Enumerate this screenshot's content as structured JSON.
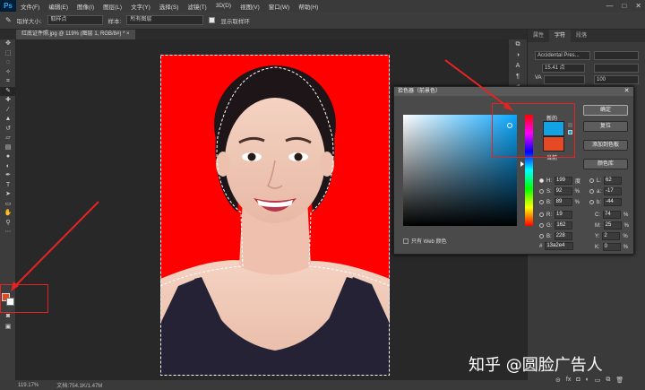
{
  "app": {
    "logo": "Ps"
  },
  "menu": [
    "文件(F)",
    "编辑(E)",
    "图像(I)",
    "图层(L)",
    "文字(Y)",
    "选择(S)",
    "滤镜(T)",
    "3D(D)",
    "视图(V)",
    "窗口(W)",
    "帮助(H)"
  ],
  "window_controls": [
    "—",
    "□",
    "✕"
  ],
  "options": {
    "sample_size_label": "取样大小:",
    "sample_size_value": "取样点",
    "sample_label": "样本:",
    "sample_value": "所有图层",
    "show_ring_label": "显示取样环"
  },
  "document_tab": "红底证件照.jpg @ 119% (图层 1, RGB/8#) * ×",
  "status": {
    "zoom": "119.17%",
    "doc": "文档:754.1K/1.47M"
  },
  "right_panel": {
    "tabs": [
      "属性",
      "字符",
      "段落"
    ],
    "active_tab": "字符",
    "font_family": "Accidental Pres...",
    "font_size": "15.41 点",
    "leading_label": "VA",
    "tracking": "100"
  },
  "color_picker": {
    "title": "拾色器（前景色）",
    "new_label": "新的",
    "current_label": "当前",
    "new_color": "#13a2e4",
    "current_color": "#e64a25",
    "buttons": {
      "ok": "确定",
      "reset": "复位",
      "add_swatch": "添加到色板",
      "libraries": "颜色库"
    },
    "only_web_label": "只有 Web 颜色",
    "hsb": {
      "h": "199",
      "h_unit": "度",
      "s": "92",
      "s_unit": "%",
      "b": "89",
      "b_unit": "%"
    },
    "rgb": {
      "r": "19",
      "g": "162",
      "b": "228"
    },
    "lab": {
      "l": "62",
      "a": "-17",
      "b": "-44"
    },
    "cmyk": {
      "c": "74",
      "m": "25",
      "y": "2",
      "k": "0",
      "unit": "%"
    },
    "hex": "13a2e4"
  },
  "watermark": "知乎 @圆脸广告人",
  "colors": {
    "photo_background": "#ff0000",
    "foreground": "#e64a25",
    "background": "#ffffff",
    "highlight": "#e62222"
  }
}
